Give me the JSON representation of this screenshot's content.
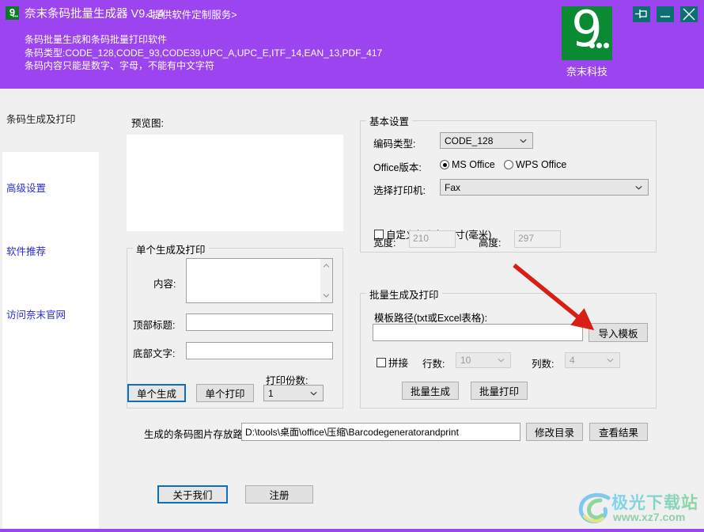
{
  "window": {
    "app_icon_glyph": "9",
    "title": "奈末条码批量生成器 V9.1.4",
    "subtitle": "<提供软件定制服务>",
    "description_lines": [
      "条码批量生成和条码批量打印软件",
      "条码类型:CODE_128,CODE_93,CODE39,UPC_A,UPC_E,ITF_14,EAN_13,PDF_417",
      "条码内容只能是数字、字母，不能有中文字符"
    ],
    "logo": {
      "glyph": "9",
      "caption": "奈末科技"
    },
    "controls": [
      {
        "name": "pin-button",
        "icon": "pin-icon"
      },
      {
        "name": "minimize-button",
        "icon": "minimize-icon"
      },
      {
        "name": "close-button",
        "icon": "close-icon"
      }
    ],
    "colors": {
      "titlebar": "#9b44f0",
      "logo_green": "#0a8a33",
      "winbtn": "#0d6f72",
      "focus_blue": "#0d6ebd"
    }
  },
  "sidebar": {
    "header": "条码生成及打印",
    "links": [
      "高级设置",
      "软件推荐",
      "访问奈末官网"
    ]
  },
  "preview": {
    "label": "预览图:"
  },
  "single": {
    "group_title": "单个生成及打印",
    "content_label": "内容:",
    "content_value": "",
    "top_title_label": "顶部标题:",
    "top_title_value": "",
    "bottom_text_label": "底部文字:",
    "bottom_text_value": "",
    "copies_label": "打印份数:",
    "copies_value": "1",
    "generate_button": "单个生成",
    "print_button": "单个打印"
  },
  "basic": {
    "group_title": "基本设置",
    "code_type_label": "编码类型:",
    "code_type_value": "CODE_128",
    "office_label": "Office版本:",
    "office_options": [
      {
        "label": "MS Office",
        "selected": true
      },
      {
        "label": "WPS Office",
        "selected": false
      }
    ],
    "printer_label": "选择打印机:",
    "printer_value": "Fax",
    "custom_size_label": "自定义打印机尺寸(毫米)",
    "custom_size_checked": false,
    "width_label": "宽度:",
    "width_value": "210",
    "height_label": "高度:",
    "height_value": "297"
  },
  "batch": {
    "group_title": "批量生成及打印",
    "template_path_label": "模板路径(txt或Excel表格):",
    "template_path_value": "",
    "import_button": "导入模板",
    "splice_label": "拼接",
    "splice_checked": false,
    "rows_label": "行数:",
    "rows_value": "10",
    "cols_label": "列数:",
    "cols_value": "4",
    "batch_generate_button": "批量生成",
    "batch_print_button": "批量打印"
  },
  "output": {
    "path_label": "生成的条码图片存放路径:",
    "path_value": "D:\\tools\\桌面\\office\\压缩\\Barcodegeneratorandprint",
    "change_dir_button": "修改目录",
    "view_result_button": "查看结果"
  },
  "footer": {
    "about_button": "关于我们",
    "register_button": "注册"
  },
  "watermark": {
    "name": "极光下载站",
    "url": "www.xz7.com"
  },
  "annotation": {
    "arrow_color": "#d81f15"
  }
}
